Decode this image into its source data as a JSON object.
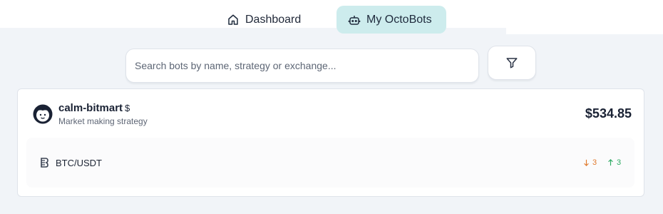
{
  "nav": {
    "dashboard_label": "Dashboard",
    "dashboard_icon": "home-icon",
    "octobots_label": "My OctoBots",
    "octobots_icon": "robot-icon",
    "active": "My OctoBots"
  },
  "search": {
    "placeholder": "Search bots by name, strategy or exchange...",
    "value": ""
  },
  "filter": {
    "icon": "filter-icon"
  },
  "bot": {
    "name": "calm-bitmart",
    "currency": "$",
    "strategy": "Market making strategy",
    "value": "$534.85",
    "pair": {
      "label": "BTC/USDT",
      "exchange_icon": "bitmart-icon",
      "down_count": "3",
      "up_count": "3"
    }
  },
  "colors": {
    "accent": "#cdeced",
    "down": "#e07a2e",
    "up": "#2eaa63"
  }
}
